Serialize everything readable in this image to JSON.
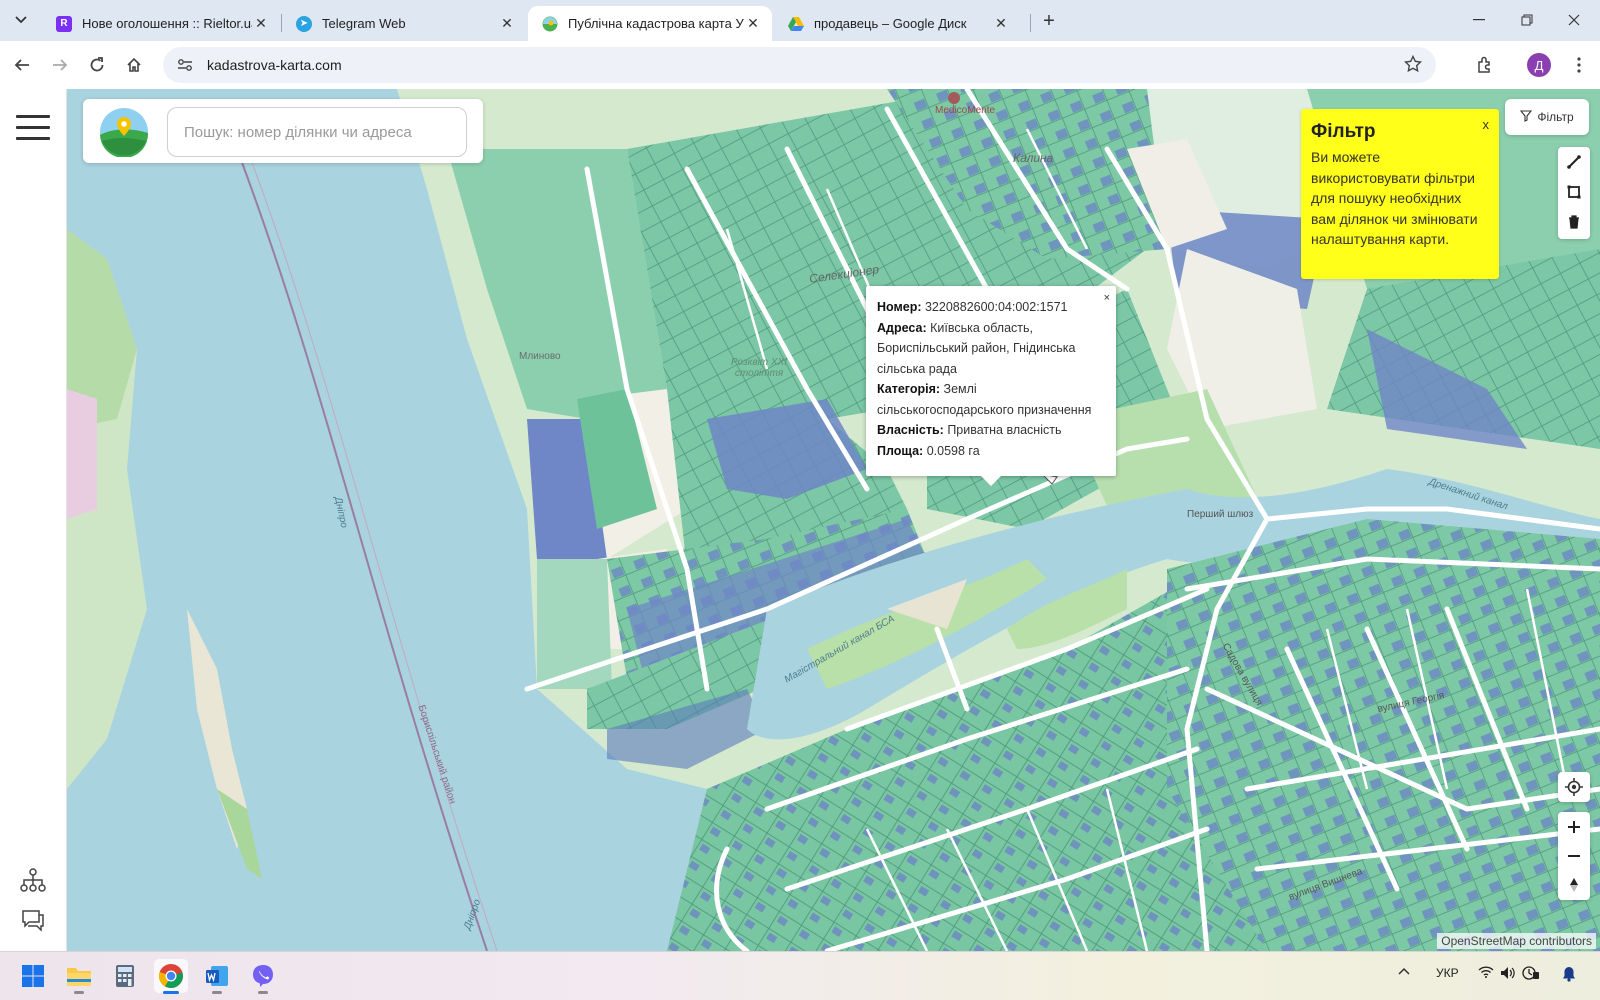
{
  "browser": {
    "tabs": [
      {
        "title": "Нове оголошення :: Rieltor.ua",
        "favicon": "rieltor-icon",
        "color": "#7b2ff7"
      },
      {
        "title": "Telegram Web",
        "favicon": "telegram-icon",
        "color": "#2aa3e0"
      },
      {
        "title": "Публічна кадастрова карта Укр",
        "favicon": "kadastr-icon",
        "color": "#4caf50"
      },
      {
        "title": "продавець – Google Диск",
        "favicon": "google-drive-icon",
        "color": "#fbbc04"
      }
    ],
    "active_tab_index": 2,
    "url": "kadastrova-karta.com",
    "profile_initial": "Д"
  },
  "app": {
    "search_placeholder": "Пошук: номер ділянки чи адреса",
    "filter_button": "Фільтр",
    "filter_tip": {
      "title": "Фільтр",
      "text": "Ви можете використовувати фільтри для пошуку необхідних вам ділянок чи змінювати налаштування карти.",
      "close": "x"
    },
    "popup": {
      "close": "×",
      "number_label": "Номер:",
      "number": "3220882600:04:002:1571",
      "address_label": "Адреса:",
      "address": "Київська область, Бориспільський район, Гнідинська сільська рада",
      "category_label": "Категорія:",
      "category": "Землі сільськогосподарського призначення",
      "ownership_label": "Власність:",
      "ownership": "Приватна власність",
      "area_label": "Площа:",
      "area": "0.0598 га"
    },
    "attribution": "OpenStreetMap contributors"
  },
  "map_labels": {
    "mlynovo": "Млиново",
    "razvit": "Розквіт XXI століття",
    "selektsioner": "Селекціонер",
    "kalyna": "Калина",
    "pershyi": "Перший шлюз",
    "drenazhnyi": "Дренажний канал",
    "mahistralnyi": "Магістральний канал БСА",
    "dnipro1": "Дніпро",
    "dnipro2": "Дніпро",
    "medicamente": "MedicoMente",
    "sadova": "Садова вулиця",
    "vyshneva": "вулиця Вишнева",
    "georgiya": "вулиця Георгія",
    "borysp": "Бориспільський район"
  },
  "taskbar": {
    "apps": [
      "windows-start-icon",
      "file-explorer-icon",
      "calculator-icon",
      "chrome-icon",
      "word-icon",
      "viber-icon"
    ],
    "language": "УКР"
  },
  "colors": {
    "water": "#a9d3df",
    "land": "#cfe7c9",
    "parcel_green": "#79c7a3",
    "parcel_blue": "#6f86c7",
    "accent_yellow": "#ffff1a"
  }
}
